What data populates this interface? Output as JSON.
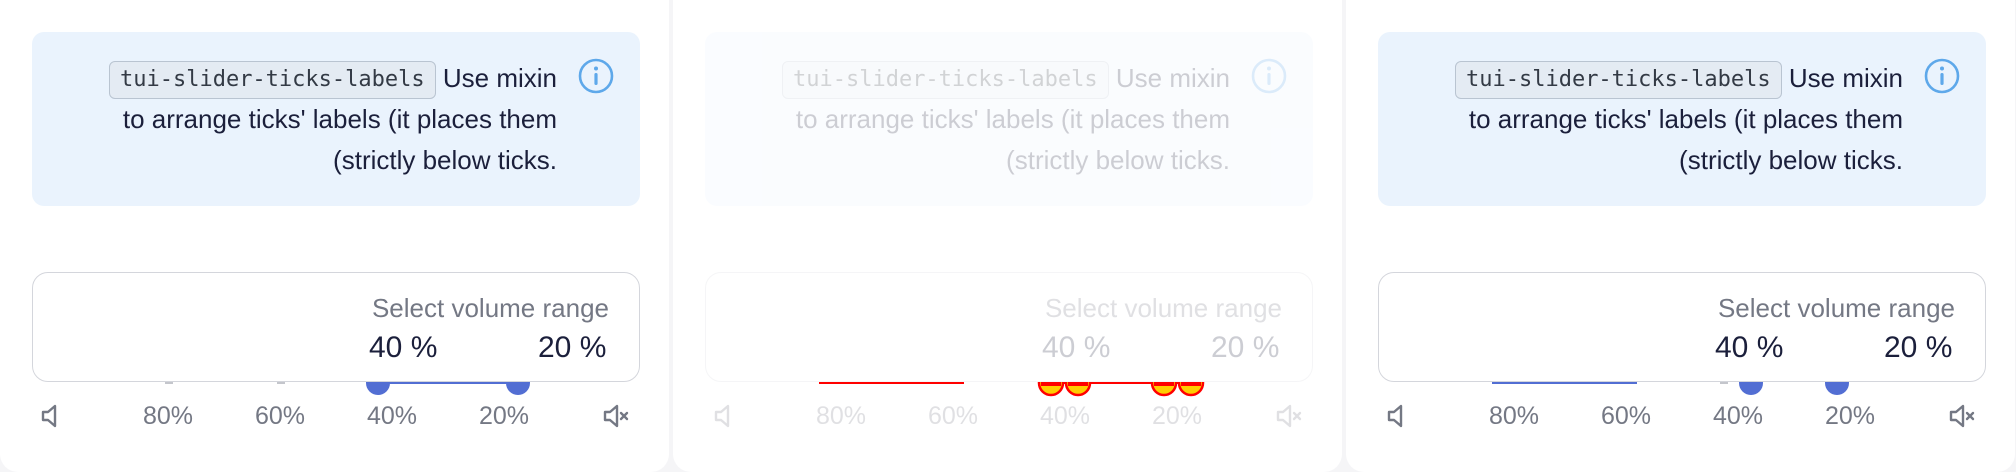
{
  "panels": [
    {
      "state": "normal",
      "note": {
        "line1_prefix": "Use mixin",
        "code": "tui-slider-ticks-labels",
        "line2": "to arrange ticks' labels (it places them",
        "line3": ".strictly below ticks)"
      },
      "range": {
        "label": "Select volume range",
        "value_left": "% 40",
        "value_right": "% 20"
      },
      "ticks": [
        "80%",
        "60%",
        "40%",
        "20%"
      ],
      "icons": {
        "info": "info-icon",
        "volume_low": "volume-low-icon",
        "mute": "volume-mute-icon"
      }
    },
    {
      "state": "disabled",
      "note": {
        "line1_prefix": "Use mixin",
        "code": "tui-slider-ticks-labels",
        "line2": "to arrange ticks' labels (it places them",
        "line3": ".strictly below ticks)"
      },
      "range": {
        "label": "Select volume range",
        "value_left": "% 40",
        "value_right": "% 20"
      },
      "ticks": [
        "80%",
        "60%",
        "40%",
        "20%"
      ],
      "icons": {
        "info": "info-icon",
        "volume_low": "volume-low-icon",
        "mute": "volume-mute-icon"
      }
    },
    {
      "state": "normal",
      "note": {
        "line1_prefix": "Use mixin",
        "code": "tui-slider-ticks-labels",
        "line2": "to arrange ticks' labels (it places them",
        "line3": ".strictly below ticks)"
      },
      "range": {
        "label": "Select volume range",
        "value_left": "% 40",
        "value_right": "% 20"
      },
      "ticks": [
        "80%",
        "60%",
        "40%",
        "20%"
      ],
      "icons": {
        "info": "info-icon",
        "volume_low": "volume-low-icon",
        "mute": "volume-mute-icon"
      }
    }
  ],
  "colors": {
    "accent": "#526ed3",
    "note_bg": "#eaf3fd",
    "info_icon": "#5ea8ea",
    "error": "#ff0000",
    "error_fill": "#ffcc00"
  }
}
